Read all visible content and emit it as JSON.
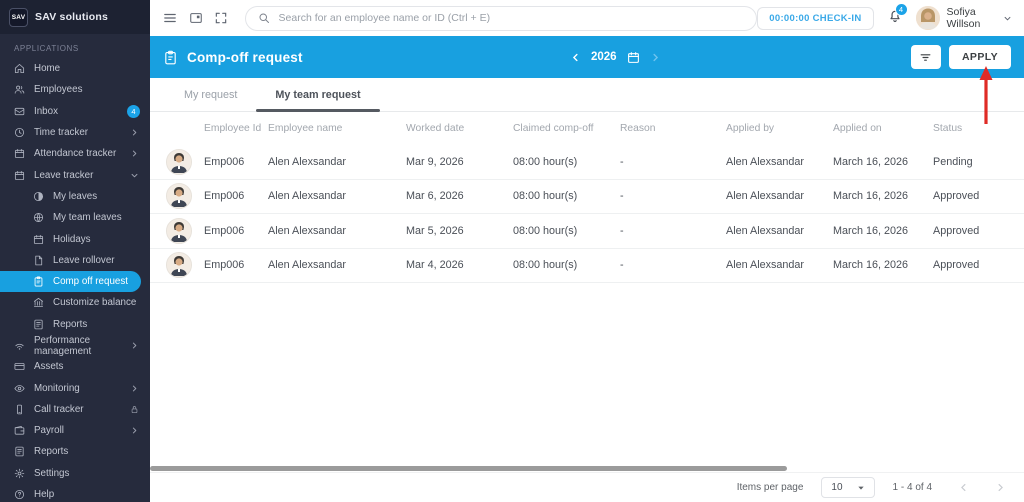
{
  "app": {
    "logo_text": "SAV",
    "brand": "SAV solutions"
  },
  "topbar": {
    "search_placeholder": "Search for an employee name or ID (Ctrl + E)",
    "checkin_label": "00:00:00 CHECK-IN",
    "notification_count": "4",
    "user_name": "Sofiya Willson"
  },
  "sidebar": {
    "section_label": "APPLICATIONS",
    "items": [
      {
        "label": "Home",
        "icon": "home-icon",
        "sub": false
      },
      {
        "label": "Employees",
        "icon": "people-icon",
        "sub": false
      },
      {
        "label": "Inbox",
        "icon": "inbox-icon",
        "sub": false,
        "badge": "4"
      },
      {
        "label": "Time tracker",
        "icon": "clock-icon",
        "sub": false,
        "trailing": "chevron-right-icon"
      },
      {
        "label": "Attendance tracker",
        "icon": "calendar-icon",
        "sub": false,
        "trailing": "chevron-right-icon"
      },
      {
        "label": "Leave tracker",
        "icon": "calendar-icon",
        "sub": false,
        "trailing": "chevron-down-icon"
      },
      {
        "label": "My leaves",
        "icon": "contrast-icon",
        "sub": true
      },
      {
        "label": "My team leaves",
        "icon": "globe-icon",
        "sub": true
      },
      {
        "label": "Holidays",
        "icon": "calendar-icon",
        "sub": true
      },
      {
        "label": "Leave rollover",
        "icon": "file-icon",
        "sub": true
      },
      {
        "label": "Comp off request",
        "icon": "clipboard-icon",
        "sub": true,
        "active": true
      },
      {
        "label": "Customize balance",
        "icon": "bank-icon",
        "sub": true
      },
      {
        "label": "Reports",
        "icon": "report-icon",
        "sub": true
      },
      {
        "label": "Performance management",
        "icon": "performance-icon",
        "sub": false,
        "trailing": "chevron-right-icon"
      },
      {
        "label": "Assets",
        "icon": "card-icon",
        "sub": false
      },
      {
        "label": "Monitoring",
        "icon": "eye-icon",
        "sub": false,
        "trailing": "chevron-right-icon"
      },
      {
        "label": "Call tracker",
        "icon": "phone-icon",
        "sub": false,
        "trailing": "lock-icon"
      },
      {
        "label": "Payroll",
        "icon": "wallet-icon",
        "sub": false,
        "trailing": "chevron-right-icon"
      },
      {
        "label": "Reports",
        "icon": "report-icon",
        "sub": false
      },
      {
        "label": "Settings",
        "icon": "gear-icon",
        "sub": false
      },
      {
        "label": "Help",
        "icon": "help-icon",
        "sub": false
      }
    ]
  },
  "page_header": {
    "title": "Comp-off request",
    "year": "2026"
  },
  "toolbar": {
    "apply_label": "APPLY"
  },
  "tabs": [
    {
      "label": "My request",
      "active": false
    },
    {
      "label": "My team request",
      "active": true
    }
  ],
  "table": {
    "columns": [
      "Employee Id",
      "Employee name",
      "Worked date",
      "Claimed comp-off",
      "Reason",
      "Applied by",
      "Applied on",
      "Status"
    ],
    "rows": [
      {
        "employee_id": "Emp006",
        "employee_name": "Alen Alexsandar",
        "worked_date": "Mar 9, 2026",
        "claimed": "08:00 hour(s)",
        "reason": "-",
        "applied_by": "Alen Alexsandar",
        "applied_on": "March 16, 2026",
        "status": "Pending"
      },
      {
        "employee_id": "Emp006",
        "employee_name": "Alen Alexsandar",
        "worked_date": "Mar 6, 2026",
        "claimed": "08:00 hour(s)",
        "reason": "-",
        "applied_by": "Alen Alexsandar",
        "applied_on": "March 16, 2026",
        "status": "Approved"
      },
      {
        "employee_id": "Emp006",
        "employee_name": "Alen Alexsandar",
        "worked_date": "Mar 5, 2026",
        "claimed": "08:00 hour(s)",
        "reason": "-",
        "applied_by": "Alen Alexsandar",
        "applied_on": "March 16, 2026",
        "status": "Approved"
      },
      {
        "employee_id": "Emp006",
        "employee_name": "Alen Alexsandar",
        "worked_date": "Mar 4, 2026",
        "claimed": "08:00 hour(s)",
        "reason": "-",
        "applied_by": "Alen Alexsandar",
        "applied_on": "March 16, 2026",
        "status": "Approved"
      }
    ]
  },
  "pagination": {
    "items_per_page_label": "Items per page",
    "page_size": "10",
    "range_label": "1 - 4 of 4"
  },
  "annotation": {
    "type": "arrow-up",
    "target": "apply-button",
    "color": "#df2b26"
  },
  "colors": {
    "accent_blue": "#18a0e0",
    "sidebar_bg": "#262b3d",
    "sidebar_header_bg": "#1d2232",
    "badge_blue": "#1ba3e8",
    "annotation_red": "#df2b26"
  }
}
